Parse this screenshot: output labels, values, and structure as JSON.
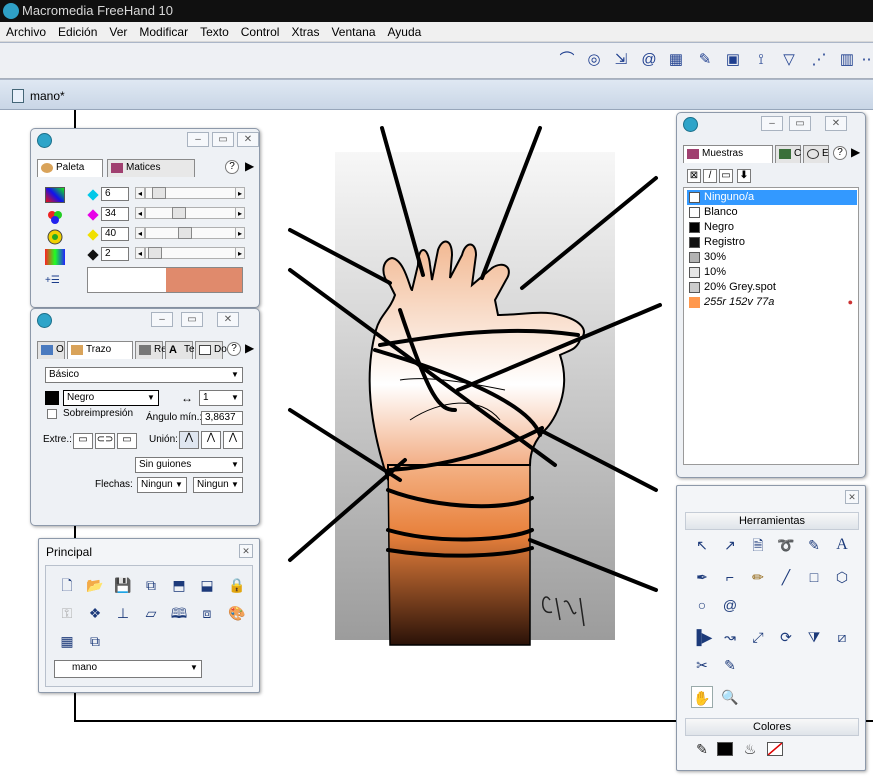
{
  "app": {
    "title": "Macromedia FreeHand 10"
  },
  "menu": [
    "Archivo",
    "Edición",
    "Ver",
    "Modificar",
    "Texto",
    "Control",
    "Xtras",
    "Ventana",
    "Ayuda"
  ],
  "document": {
    "tab_name": "mano*"
  },
  "panel_color": {
    "tabs": [
      "Paleta",
      "Matices"
    ],
    "help": "?",
    "values": [
      "6",
      "34",
      "40",
      "2"
    ],
    "channel_colors": [
      "#00c8e8",
      "#e800e8",
      "#f0e000",
      "#111111"
    ],
    "preview_colors": [
      "#ffffff",
      "#e08a6c"
    ]
  },
  "panel_stroke": {
    "tabs": [
      "O",
      "Trazo",
      "Re",
      "Te",
      "Doc"
    ],
    "type": "Básico",
    "color": "Negro",
    "width": "1",
    "overprint_label": "Sobreimpresión",
    "angle_label": "Ángulo mín.:",
    "angle_value": "3,8637",
    "ends_label": "Extre.:",
    "join_label": "Unión:",
    "dash": "Sin guiones",
    "arrows_label": "Flechas:",
    "arrow_start": "Ningun",
    "arrow_end": "Ningun"
  },
  "panel_main": {
    "title": "Principal",
    "doc_select": "mano"
  },
  "panel_swatches": {
    "tabs": [
      "Muestras",
      "C",
      "E"
    ],
    "items": [
      {
        "label": "Ninguno/a",
        "color": "none",
        "selected": true
      },
      {
        "label": "Blanco",
        "color": "#ffffff"
      },
      {
        "label": "Negro",
        "color": "#000000"
      },
      {
        "label": "Registro",
        "color": "#000000"
      },
      {
        "label": "30%",
        "color": "#b3b3b3"
      },
      {
        "label": "10%",
        "color": "#e6e6e6"
      },
      {
        "label": "20% Grey.spot",
        "color": "#cccccc"
      },
      {
        "label": "255r 152v 77a",
        "color": "#ff984d"
      }
    ]
  },
  "panel_tools": {
    "title": "Herramientas",
    "colors_title": "Colores"
  }
}
